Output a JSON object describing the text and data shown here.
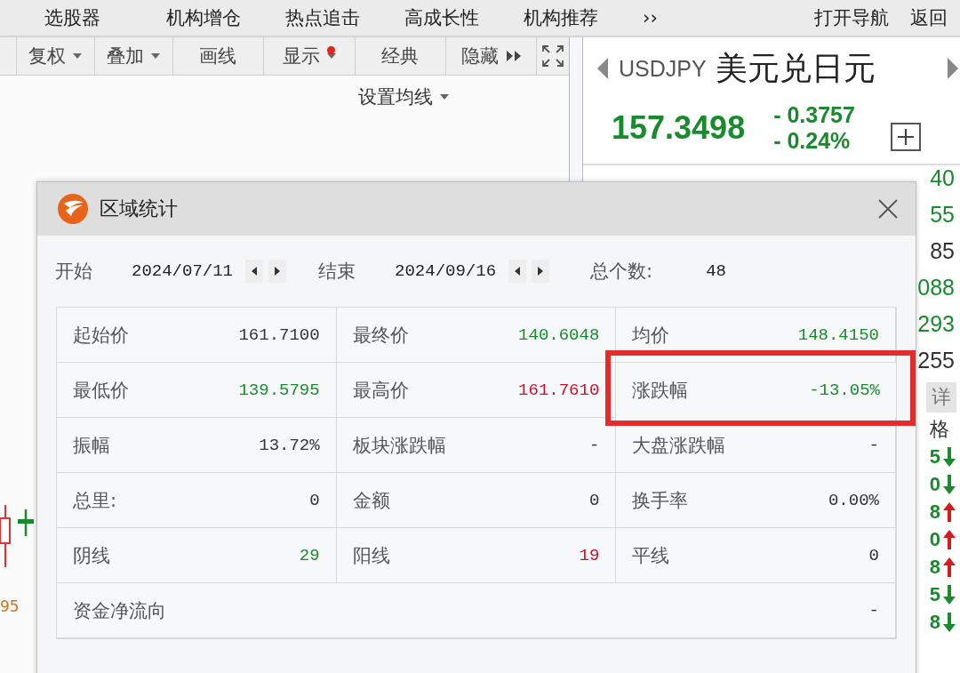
{
  "menu": {
    "items": [
      "选股器",
      "机构增仓",
      "热点追击",
      "高成长性",
      "机构推荐"
    ],
    "more": "››",
    "right_items": [
      "打开导航",
      "返回"
    ]
  },
  "toolbar": {
    "buttons": [
      {
        "label": "复权",
        "dropdown": true,
        "badge": false,
        "kind": "text"
      },
      {
        "label": "叠加",
        "dropdown": true,
        "badge": false,
        "kind": "text"
      },
      {
        "label": "画线",
        "dropdown": false,
        "badge": false,
        "kind": "text"
      },
      {
        "label": "显示",
        "dropdown": true,
        "badge": true,
        "kind": "text"
      },
      {
        "label": "经典",
        "dropdown": false,
        "badge": false,
        "kind": "text"
      },
      {
        "label": "隐藏",
        "dropdown": false,
        "badge": false,
        "kind": "collapse"
      },
      {
        "kind": "fullscreen"
      }
    ]
  },
  "chart": {
    "ma_setting": "设置均线",
    "price_label": "95"
  },
  "quote": {
    "symbol": "USDJPY",
    "name": "美元兑日元",
    "price": "157.3498",
    "change": "- 0.3757",
    "change_pct": "- 0.24%",
    "levels": [
      {
        "value": "40",
        "color": "#1a8a2e"
      },
      {
        "value": "55",
        "color": "#1a8a2e"
      },
      {
        "value": "85",
        "color": "#333333"
      },
      {
        "value": "088",
        "color": "#1a8a2e"
      },
      {
        "value": "293",
        "color": "#1a8a2e"
      },
      {
        "value": "255",
        "color": "#333333"
      }
    ],
    "detail_button": "详",
    "ticks_header": "格",
    "ticks": [
      {
        "digit": "5",
        "kind": "down"
      },
      {
        "digit": "0",
        "kind": "down"
      },
      {
        "digit": "8",
        "kind": "up"
      },
      {
        "digit": "0",
        "kind": "up"
      },
      {
        "digit": "8",
        "kind": "up"
      },
      {
        "digit": "5",
        "kind": "down"
      },
      {
        "digit": "8",
        "kind": "down"
      }
    ]
  },
  "dialog": {
    "title": "区域统计",
    "range": {
      "start_label": "开始",
      "start": "2024/07/11",
      "end_label": "结束",
      "end": "2024/09/16",
      "count_label": "总个数:",
      "count": "48"
    },
    "rows": [
      [
        {
          "label": "起始价",
          "value": "161.7100",
          "color": "#333333",
          "highlighted": false
        },
        {
          "label": "最终价",
          "value": "140.6048",
          "color": "#1a8a2e",
          "highlighted": false
        },
        {
          "label": "均价",
          "value": "148.4150",
          "color": "#1a8a2e",
          "highlighted": false
        }
      ],
      [
        {
          "label": "最低价",
          "value": "139.5795",
          "color": "#1a8a2e",
          "highlighted": false
        },
        {
          "label": "最高价",
          "value": "161.7610",
          "color": "#c8102e",
          "highlighted": false
        },
        {
          "label": "涨跌幅",
          "value": "-13.05%",
          "color": "#1a8a2e",
          "highlighted": true
        }
      ],
      [
        {
          "label": "振幅",
          "value": "13.72%",
          "color": "#333333",
          "highlighted": false
        },
        {
          "label": "板块涨跌幅",
          "value": "-",
          "color": "#333333",
          "highlighted": false
        },
        {
          "label": "大盘涨跌幅",
          "value": "-",
          "color": "#333333",
          "highlighted": false
        }
      ],
      [
        {
          "label": "总里:",
          "value": "0",
          "color": "#333333",
          "highlighted": false
        },
        {
          "label": "金额",
          "value": "0",
          "color": "#333333",
          "highlighted": false
        },
        {
          "label": "换手率",
          "value": "0.00%",
          "color": "#333333",
          "highlighted": false
        }
      ],
      [
        {
          "label": "阴线",
          "value": "29",
          "color": "#1a8a2e",
          "highlighted": false
        },
        {
          "label": "阳线",
          "value": "19",
          "color": "#c8102e",
          "highlighted": false
        },
        {
          "label": "平线",
          "value": "0",
          "color": "#333333",
          "highlighted": false
        }
      ],
      [
        {
          "label": "资金净流向",
          "value": "-",
          "color": "#333333",
          "highlighted": false
        }
      ]
    ]
  }
}
